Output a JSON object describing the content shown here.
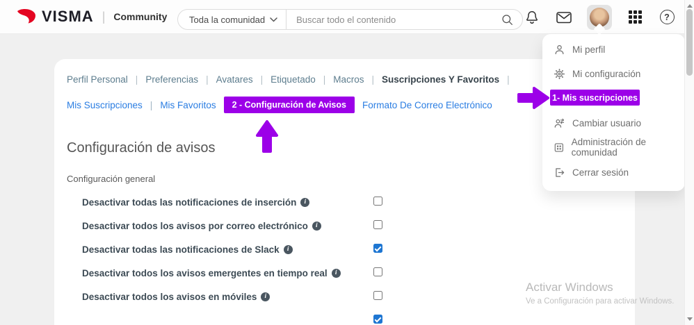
{
  "header": {
    "brand": "VISMA",
    "divider": "|",
    "product": "Community",
    "search_scope": "Toda la comunidad",
    "search_placeholder": "Buscar todo el contenido",
    "help_glyph": "?"
  },
  "user_menu": {
    "items": [
      {
        "label": "Mi perfil",
        "icon": "user-icon",
        "highlighted": false
      },
      {
        "label": "Mi configuración",
        "icon": "gear-icon",
        "highlighted": false
      },
      {
        "label": "1- Mis suscripciones",
        "icon": "",
        "highlighted": true
      },
      {
        "label": "Cambiar usuario",
        "icon": "user-switch-icon",
        "highlighted": false
      },
      {
        "label": "Administración de comunidad",
        "icon": "community-admin-icon",
        "highlighted": false
      },
      {
        "label": "Cerrar sesión",
        "icon": "logout-icon",
        "highlighted": false
      }
    ]
  },
  "nav_primary": {
    "separator": "|",
    "items": [
      "Perfil Personal",
      "Preferencias",
      "Avatares",
      "Etiquetado",
      "Macros",
      "Suscripciones Y Favoritos"
    ],
    "active": "Suscripciones Y Favoritos"
  },
  "nav_secondary": {
    "separator": "|",
    "items": [
      "Mis Suscripciones",
      "Mis Favoritos",
      "2 - Configuración de Avisos",
      "Formato De Correo Electrónico"
    ],
    "active": "2 - Configuración de Avisos"
  },
  "content": {
    "title": "Configuración de avisos",
    "section_label": "Configuración general",
    "info_glyph": "i",
    "settings": [
      {
        "label": "Desactivar todas las notificaciones de inserción",
        "checked": false
      },
      {
        "label": "Desactivar todos los avisos por correo electrónico",
        "checked": false
      },
      {
        "label": "Desactivar todas las notificaciones de Slack",
        "checked": true
      },
      {
        "label": "Desactivar todos los avisos emergentes en tiempo real",
        "checked": false
      },
      {
        "label": "Desactivar todos los avisos en móviles",
        "checked": false
      },
      {
        "label": "",
        "checked": true
      }
    ]
  },
  "watermark": {
    "line1": "Activar Windows",
    "line2": "Ve a Configuración para activar Windows."
  },
  "colors": {
    "accent_purple": "#9c00e8",
    "link_blue": "#2a7de2",
    "nav_slate": "#5d7d8e",
    "checkbox_blue": "#1e76d2",
    "brand_red": "#e40521"
  }
}
